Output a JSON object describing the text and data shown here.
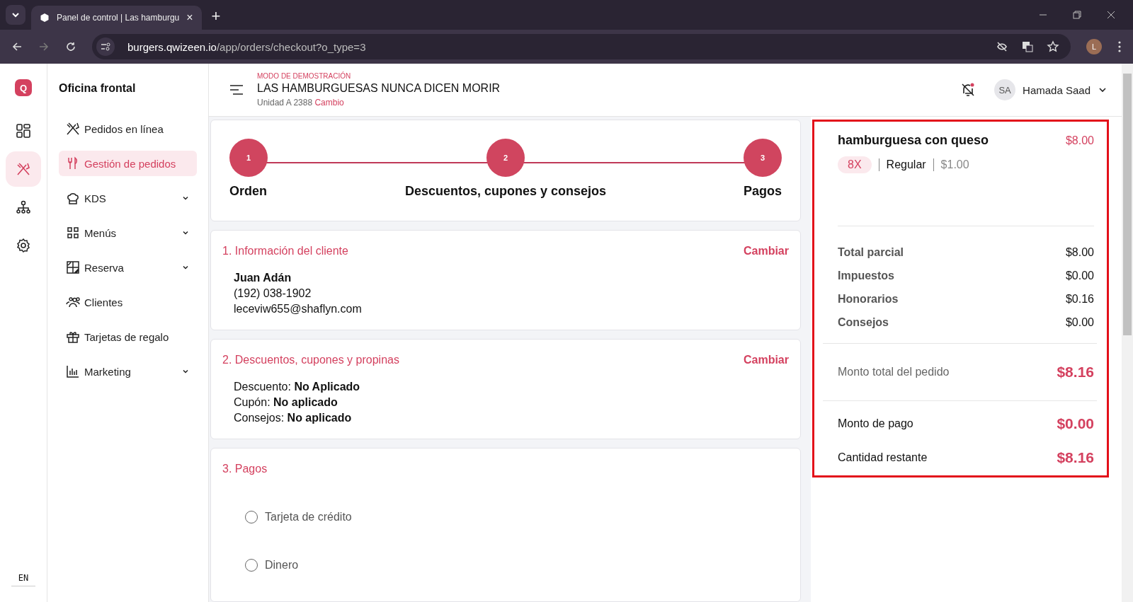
{
  "browser": {
    "tab_title": "Panel de control | Las hamburgu",
    "tab_close": "×",
    "new_tab": "+",
    "url_host": "burgers.qwizeen.io",
    "url_path": "/app/orders/checkout?o_type=3",
    "profile": "L"
  },
  "rail": {
    "logo": "Q",
    "items": [
      {
        "selected": false
      },
      {
        "selected": true
      },
      {
        "selected": false
      },
      {
        "selected": false
      }
    ],
    "language": "EN"
  },
  "sidebar": {
    "title": "Oficina frontal",
    "items": [
      {
        "label": "Pedidos en línea",
        "selected": false,
        "has_submenu": false
      },
      {
        "label": "Gestión de pedidos",
        "selected": true,
        "has_submenu": false
      },
      {
        "label": "KDS",
        "selected": false,
        "has_submenu": true
      },
      {
        "label": "Menús",
        "selected": false,
        "has_submenu": true
      },
      {
        "label": "Reserva",
        "selected": false,
        "has_submenu": true
      },
      {
        "label": "Clientes",
        "selected": false,
        "has_submenu": false
      },
      {
        "label": "Tarjetas de regalo",
        "selected": false,
        "has_submenu": false
      },
      {
        "label": "Marketing",
        "selected": false,
        "has_submenu": true
      }
    ]
  },
  "header": {
    "mode": "MODO DE DEMOSTRACIÓN",
    "restaurant": "LAS HAMBURGUESAS NUNCA DICEN MORIR",
    "unit": "Unidad A 2388",
    "change": "Cambio",
    "user_initials": "SA",
    "user_name": "Hamada Saad"
  },
  "steps": [
    {
      "number": "1",
      "label": "Orden"
    },
    {
      "number": "2",
      "label": "Descuentos, cupones y consejos"
    },
    {
      "number": "3",
      "label": "Pagos"
    }
  ],
  "customer": {
    "title": "1. Información del cliente",
    "action": "Cambiar",
    "name": "Juan Adán",
    "phone": "(192) 038-1902",
    "email": "leceviw655@shaflyn.com"
  },
  "discounts": {
    "title": "2. Descuentos, cupones y propinas",
    "action": "Cambiar",
    "lines": [
      "Descuento: **No Aplicado**",
      "Cupón: **No aplicado**",
      "Consejos: **No aplicado**"
    ]
  },
  "payments": {
    "title": "3. Pagos",
    "options": [
      {
        "label": "Tarjeta de crédito",
        "selected": false
      },
      {
        "label": "Dinero",
        "selected": false
      }
    ]
  },
  "summary": {
    "item": {
      "name": "hamburguesa con queso",
      "price": "$8.00",
      "quantity": "8X",
      "variant": "Regular",
      "unit_price": "$1.00"
    },
    "lines": [
      {
        "label": "Total parcial",
        "value": "$8.00"
      },
      {
        "label": "Impuestos",
        "value": "$0.00"
      },
      {
        "label": "Honorarios",
        "value": "$0.16"
      },
      {
        "label": "Consejos",
        "value": "$0.00"
      }
    ],
    "total": {
      "label": "Monto total del pedido",
      "value": "$8.16"
    },
    "payment": [
      {
        "label": "Monto de pago",
        "value": "$0.00"
      },
      {
        "label": "Cantidad restante",
        "value": "$8.16"
      }
    ]
  }
}
